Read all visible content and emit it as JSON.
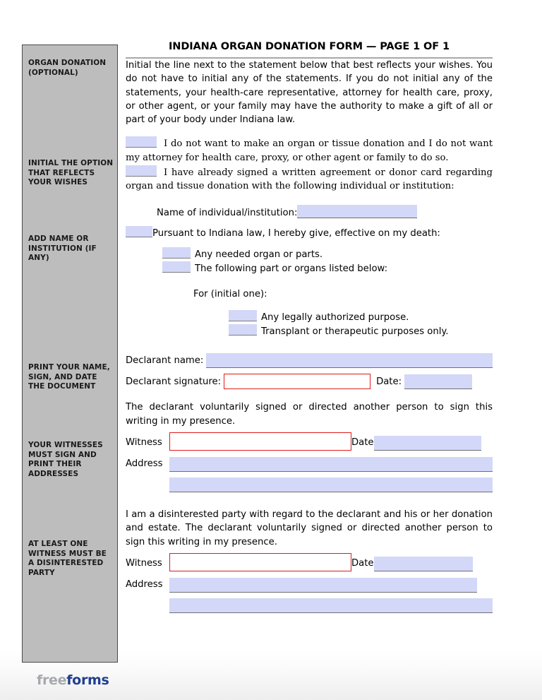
{
  "document": {
    "title": "INDIANA ORGAN DONATION FORM — PAGE 1 OF 1",
    "intro_paragraph": "Initial the line next to the statement below that best reflects your wishes. You do not have to initial any of the statements. If you do not initial any of the statements, your health-care representative, attorney for health care, proxy, or other agent, or your family may have the authority to make a gift of all or part of your body under Indiana law."
  },
  "sidebar": {
    "notes": [
      "ORGAN DONATION (OPTIONAL)",
      "INITIAL THE OPTION THAT REFLECTS YOUR WISHES",
      "ADD NAME OR INSTITUTION (IF ANY)",
      "PRINT YOUR NAME, SIGN, AND DATE THE DOCUMENT",
      "YOUR WITNESSES MUST SIGN AND PRINT THEIR ADDRESSES",
      "AT LEAST ONE WITNESS MUST BE A DISINTERESTED PARTY"
    ]
  },
  "options": {
    "option_1": "I do not want to make an organ or tissue donation and I do not want my attorney for health care, proxy, or other agent or family to do so.",
    "option_2": "I have already signed a written agreement or donor card regarding organ and tissue donation with the following individual or institution:",
    "name_institution_label": "Name of individual/institution:",
    "option_3": "Pursuant to Indiana law, I hereby give, effective on my death:",
    "sub_option_a": "Any needed organ or parts.",
    "sub_option_b": "The following part or organs listed below:",
    "for_initial_one_label": "For (initial one):",
    "purpose_a": "Any legally authorized purpose.",
    "purpose_b": "Transplant or therapeutic purposes only."
  },
  "declarant": {
    "name_label": "Declarant name:",
    "name_value": "",
    "signature_label": "Declarant signature:",
    "signature_value": "",
    "date_label": "Date:",
    "date_value": ""
  },
  "witness_1": {
    "statement": "The declarant voluntarily signed or directed another person to sign this writing in my presence.",
    "witness_label": "Witness",
    "witness_value": "",
    "date_label": "Date",
    "date_value": "",
    "address_label": "Address",
    "address_line_1": "",
    "address_line_2": ""
  },
  "witness_2": {
    "statement": "I am a disinterested party with regard to the declarant and his or her donation and estate.  The declarant voluntarily signed or directed another person to sign this writing in my presence.",
    "witness_label": "Witness",
    "witness_value": "",
    "date_label": "Date",
    "date_value": "",
    "address_label": "Address",
    "address_line_1": "",
    "address_line_2": ""
  },
  "footer": {
    "logo_first": "free",
    "logo_second": "forms"
  },
  "colors": {
    "field_fill": "#d3d7f8",
    "signature_border": "#e01b1b",
    "sidebar_bg": "#bdbdbd",
    "logo_gray": "#a7a9ac",
    "logo_blue": "#1f3f8f"
  }
}
